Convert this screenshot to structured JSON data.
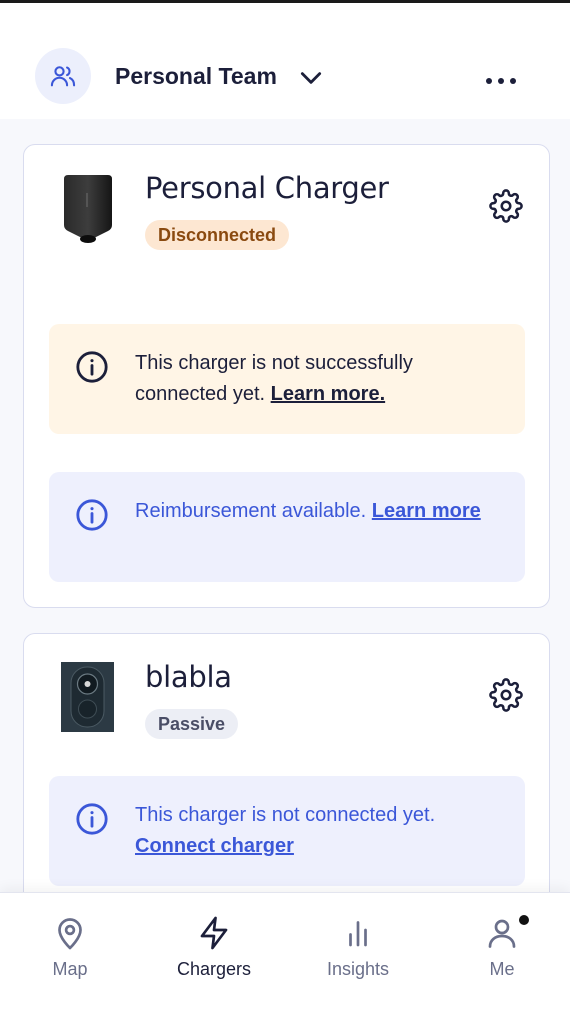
{
  "header": {
    "team_name": "Personal Team",
    "icons": {
      "team": "users-icon",
      "dropdown": "chevron-down-icon",
      "more": "more-horizontal-icon"
    }
  },
  "chargers": [
    {
      "name": "Personal Charger",
      "status": "Disconnected",
      "status_color": "#8a4a10",
      "banners": [
        {
          "type": "warning",
          "text": "This charger is not successfully connected yet.",
          "link": "Learn more."
        },
        {
          "type": "info",
          "text": "Reimbursement available.",
          "link": "Learn more"
        }
      ]
    },
    {
      "name": "blabla",
      "status": "Passive",
      "status_color": "#4a4e66",
      "banners": [
        {
          "type": "info",
          "text": "This charger is not connected yet.",
          "link": "Connect charger"
        }
      ]
    }
  ],
  "bottom_nav": [
    {
      "label": "Map",
      "icon": "map-pin-icon",
      "active": false
    },
    {
      "label": "Chargers",
      "icon": "lightning-icon",
      "active": true
    },
    {
      "label": "Insights",
      "icon": "bar-chart-icon",
      "active": false
    },
    {
      "label": "Me",
      "icon": "user-icon",
      "active": false,
      "notification": true
    }
  ],
  "colors": {
    "accent": "#3b57d8",
    "warning_bg": "#fff5e6",
    "info_bg": "#eef0fd",
    "text": "#1c1f3a"
  }
}
